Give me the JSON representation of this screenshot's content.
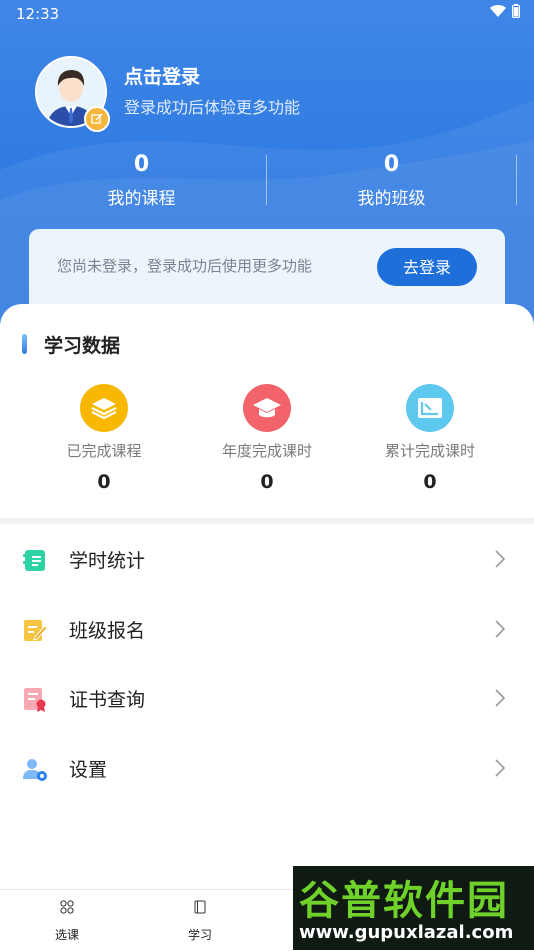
{
  "status_bar": {
    "time": "12:33"
  },
  "profile": {
    "title": "点击登录",
    "subtitle": "登录成功后体验更多功能"
  },
  "stats": [
    {
      "value": "0",
      "label": "我的课程"
    },
    {
      "value": "0",
      "label": "我的班级"
    }
  ],
  "notice": {
    "text": "您尚未登录，登录成功后使用更多功能",
    "button": "去登录"
  },
  "study_data": {
    "title": "学习数据",
    "items": [
      {
        "label": "已完成课程",
        "value": "0",
        "icon": "layers-icon",
        "color": "#f8b800"
      },
      {
        "label": "年度完成课时",
        "value": "0",
        "icon": "graduation-cap-icon",
        "color": "#f2646a"
      },
      {
        "label": "累计完成课时",
        "value": "0",
        "icon": "image-frame-icon",
        "color": "#5ec8ee"
      }
    ]
  },
  "menu": [
    {
      "label": "学时统计",
      "icon": "notebook-icon",
      "color": "#2ed3a6"
    },
    {
      "label": "班级报名",
      "icon": "edit-note-icon",
      "color": "#f7c542"
    },
    {
      "label": "证书查询",
      "icon": "certificate-icon",
      "color": "#f0657a"
    },
    {
      "label": "设置",
      "icon": "user-settings-icon",
      "color": "#4aa3ff"
    }
  ],
  "bottom_nav": [
    {
      "label": "选课",
      "icon": "grid-icon"
    },
    {
      "label": "学习",
      "icon": "book-icon"
    }
  ],
  "watermark": {
    "line1": "谷普软件园",
    "line2": "www.gupuxlazal.com"
  }
}
